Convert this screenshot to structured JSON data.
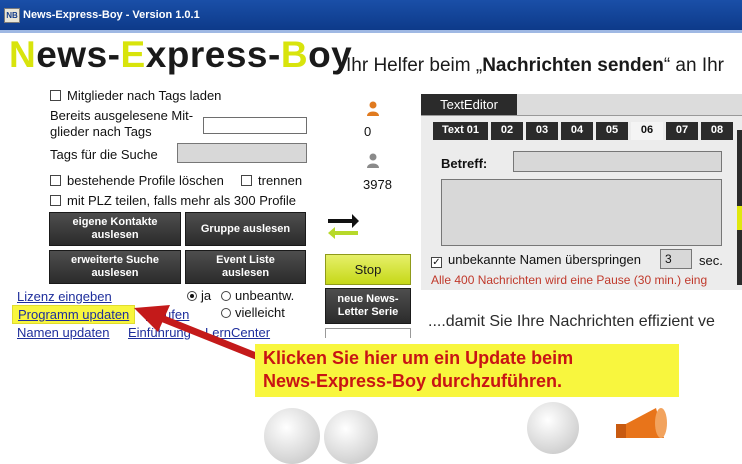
{
  "window": {
    "title": "News-Express-Boy - Version 1.0.1",
    "icon_label": "NB"
  },
  "header": {
    "logo_parts": [
      "N",
      "ews-",
      "E",
      "xpress-",
      "B",
      "oy"
    ],
    "tagline_pre": "Ihr Helfer beim „",
    "tagline_bold": "Nachrichten senden",
    "tagline_post": "“ an Ihr"
  },
  "left_panel": {
    "cb_members_tags": "Mitglieder nach Tags laden",
    "already_read_line1": "Bereits ausgelesene Mit-",
    "already_read_line2": "glieder nach Tags",
    "tags_search_label": "Tags für die Suche",
    "cb_delete_profiles": "bestehende Profile löschen",
    "cb_separate": "trennen",
    "cb_plz_split": "mit PLZ teilen, falls mehr als 300 Profile",
    "btn_own_contacts": [
      "eigene Kontakte",
      "auslesen"
    ],
    "btn_group": "Gruppe auslesen",
    "btn_extended_search": [
      "erweiterte Suche",
      "auslesen"
    ],
    "btn_event_list": [
      "Event Liste",
      "auslesen"
    ]
  },
  "links": {
    "license": "Lizenz eingeben",
    "program_update": "Programm updaten",
    "buy": "-kaufen",
    "names_update": "Namen updaten",
    "intro": "Einführung",
    "learn_center": "LernCenter"
  },
  "radios": {
    "yes": "ja",
    "unanswered": "unbeantw.",
    "maybe": "vielleicht"
  },
  "counters": {
    "person_orange_count": "0",
    "person_grey_count": "3978"
  },
  "middle": {
    "stop": "Stop",
    "newsletter": [
      "neue News-",
      "Letter Serie"
    ]
  },
  "editor": {
    "tab_label": "TextEditor",
    "text_tabs": [
      "Text 01",
      "02",
      "03",
      "04",
      "05",
      "06",
      "07",
      "08"
    ],
    "active_tab_index": 5,
    "subject_label": "Betreff:",
    "skip_unknown_label": "unbekannte Namen überspringen",
    "skip_seconds_value": "3",
    "seconds_unit": "sec.",
    "pause_notice": "Alle 400 Nachrichten wird eine Pause (30 min.) eing"
  },
  "slogan": "....damit Sie Ihre Nachrichten effizient ve",
  "callout": {
    "line1": "Klicken Sie hier um ein Update beim",
    "line2": "News-Express-Boy durchzuführen."
  },
  "icons": [
    "app-icon",
    "person-orange-icon",
    "person-grey-icon",
    "transfer-arrows-icon",
    "red-arrow-icon",
    "megaphone-icon"
  ],
  "colors": {
    "titlebar": "#0d3a8a",
    "logo_accent": "#d8e40c",
    "dark_button": "#2b2b2b",
    "stop_button": "#d4e22a",
    "callout_bg": "#f8f63e",
    "callout_text": "#c81414",
    "notice_text": "#c0392b",
    "link": "#1e2e9c",
    "highlight_link_bg": "#f8f63e",
    "arrow": "#c41a1a"
  }
}
